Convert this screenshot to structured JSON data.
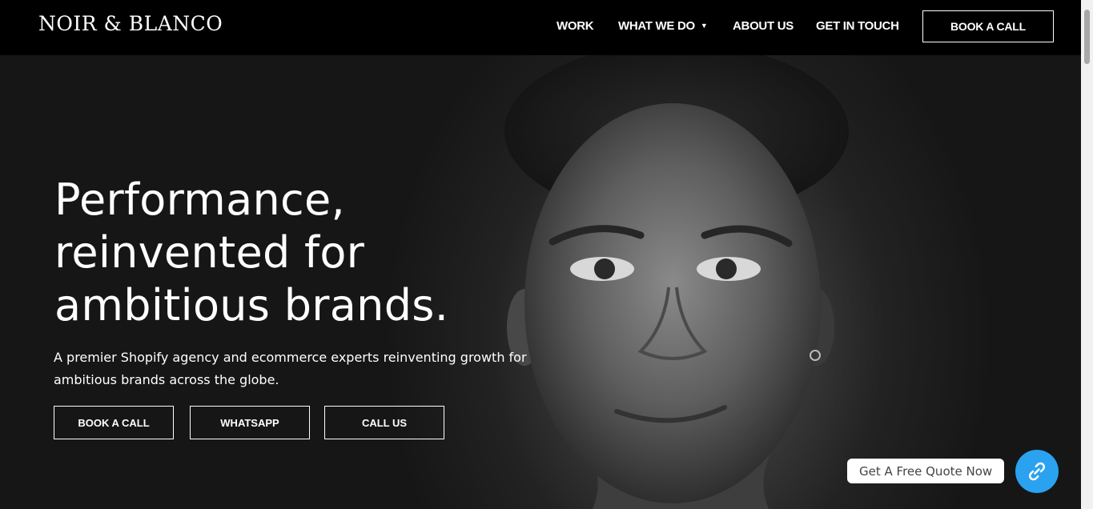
{
  "brand": {
    "logo_text": "NOIR & BLANCO"
  },
  "nav": {
    "items": [
      {
        "label": "WORK"
      },
      {
        "label": "WHAT WE DO"
      },
      {
        "label": "ABOUT US"
      },
      {
        "label": "GET IN TOUCH"
      }
    ],
    "dropdown_glyph": "⌄",
    "book_call": "BOOK A CALL"
  },
  "hero": {
    "headline": [
      "Performance,",
      "reinvented for",
      "ambitious brands."
    ],
    "subtitle": "A premier Shopify agency and ecommerce experts reinventing growth for ambitious brands across the globe.",
    "buttons": [
      {
        "label": "BOOK A CALL"
      },
      {
        "label": "WHATSAPP"
      },
      {
        "label": "CALL US"
      }
    ]
  },
  "quote_widget": {
    "label": "Get A Free Quote Now",
    "icon": "link-icon",
    "color": "#2aa2f0"
  }
}
